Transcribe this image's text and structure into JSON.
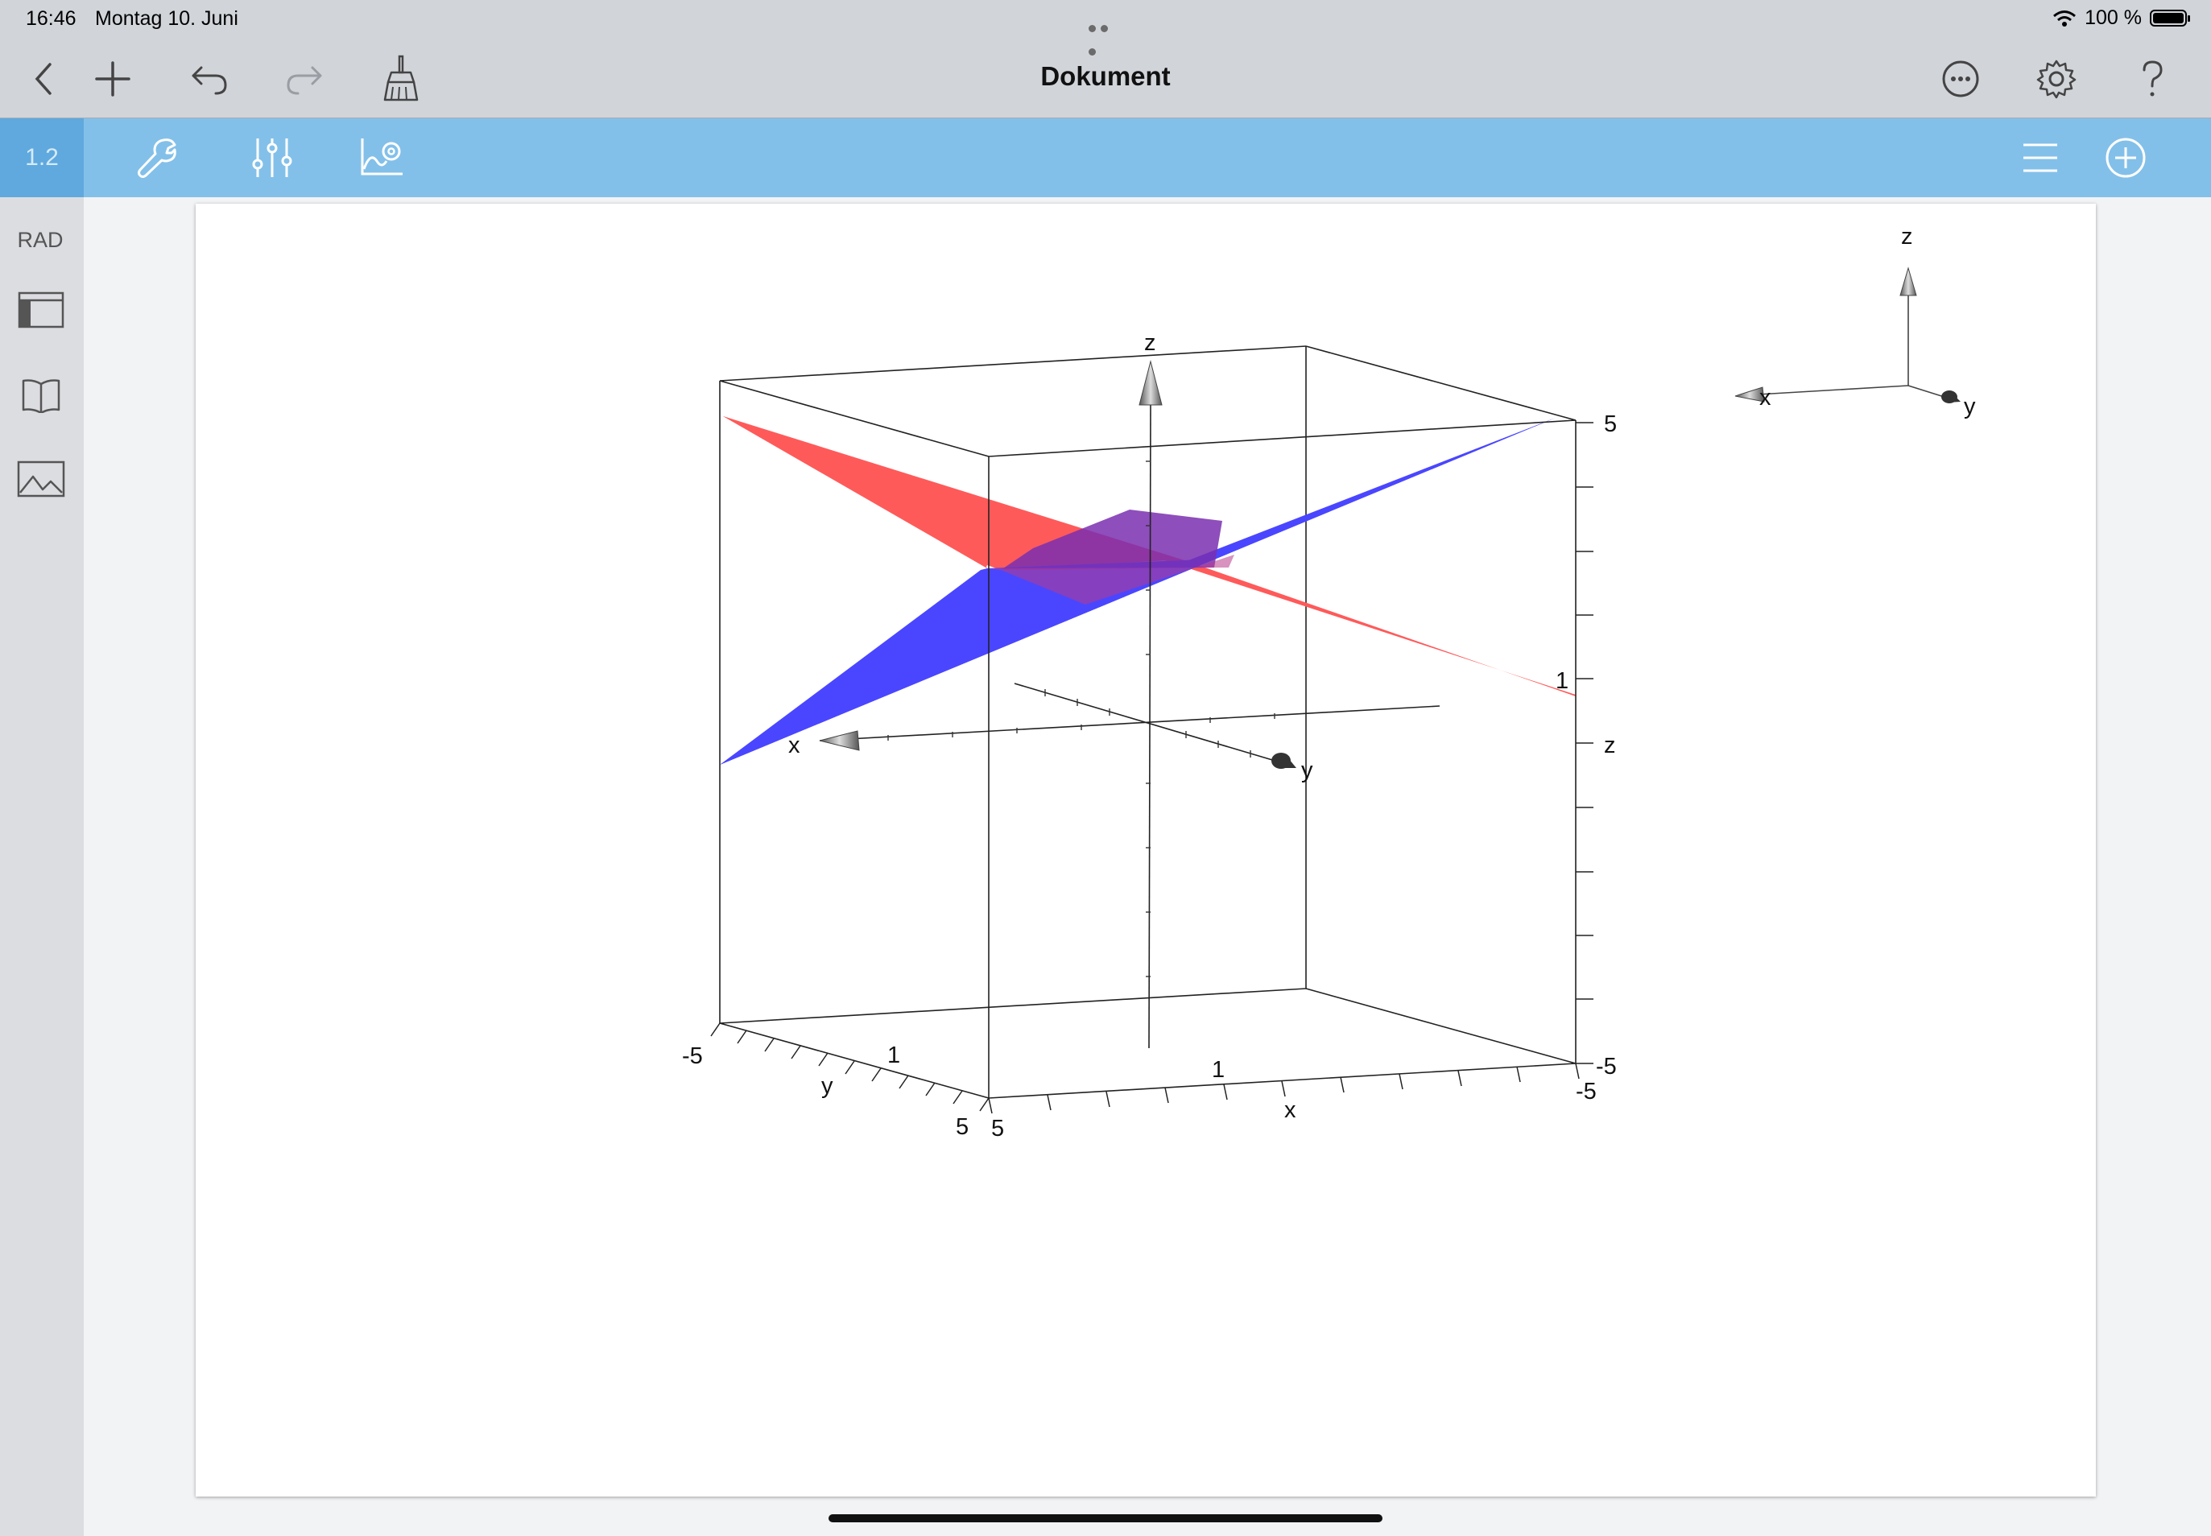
{
  "status_bar": {
    "time": "16:46",
    "date": "Montag 10. Juni",
    "battery": "100 %"
  },
  "nav_bar": {
    "title": "Dokument"
  },
  "toolbar": {
    "page_number": "1.2"
  },
  "sidebar": {
    "angle_mode": "RAD"
  },
  "graph": {
    "box_z_tick_labels": {
      "top": "5",
      "mid": "1",
      "bottom": "-5",
      "axis": "z"
    },
    "x_edge_labels": {
      "start": "5",
      "mid": "1",
      "end": "-5",
      "axis": "x"
    },
    "y_edge_labels": {
      "start": "-5",
      "mid": "1",
      "end": "5",
      "axis": "y"
    },
    "axis_labels": {
      "x": "x",
      "y": "y",
      "z": "z"
    },
    "orientation_labels": {
      "x": "x",
      "y": "y",
      "z": "z"
    },
    "colors": {
      "plane_red": "#ff5a5a",
      "plane_blue": "#4a46ff",
      "intersection": "#7a2fb0"
    }
  }
}
